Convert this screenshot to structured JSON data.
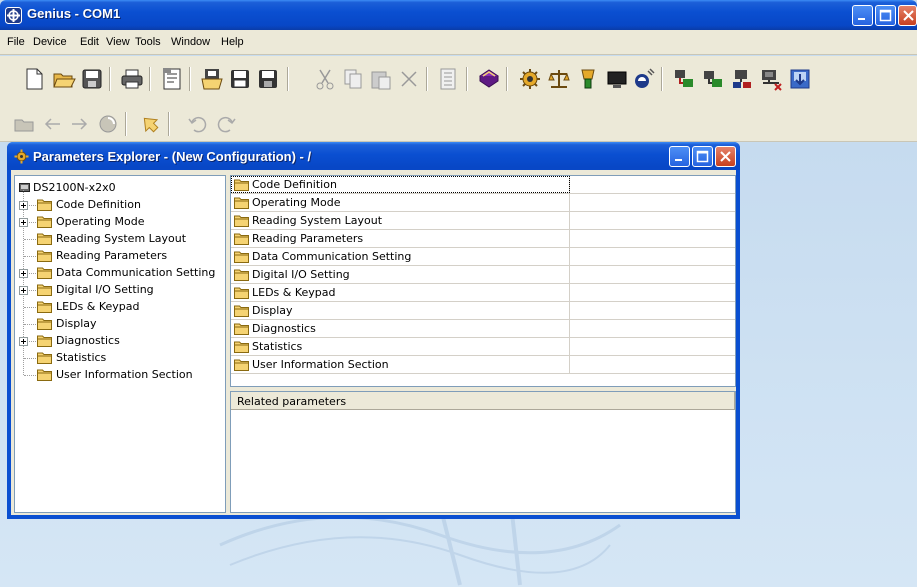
{
  "app": {
    "title": "Genius - COM1",
    "icon": "genius-app-icon"
  },
  "menu": [
    "File",
    "Device",
    "Edit",
    "View",
    "Tools",
    "Window",
    "Help"
  ],
  "toolbar": {
    "row1_icons": [
      "new-file-icon",
      "open-folder-icon",
      "save-icon",
      "print-icon",
      "properties-icon",
      "open-config-icon",
      "save-config-icon",
      "save-all-icon",
      "cut-icon",
      "copy-icon",
      "paste-icon",
      "delete-icon",
      "list-icon",
      "book-icon",
      "device-settings-icon",
      "balance-icon",
      "scanner-icon",
      "monitor-icon",
      "satellite-icon",
      "network-icon",
      "network-add-icon",
      "network-remove-icon",
      "network-error-icon",
      "download-icon"
    ],
    "row2_icons": [
      "folder-up-icon",
      "back-arrow-icon",
      "forward-arrow-icon",
      "refresh-icon",
      "send-icon",
      "undo-icon",
      "redo-icon"
    ]
  },
  "child_window": {
    "title": "Parameters Explorer - (New Configuration) - /",
    "icon": "gear-icon"
  },
  "tree": {
    "root": "DS2100N-x2x0",
    "items": [
      {
        "label": "Code Definition",
        "expandable": true
      },
      {
        "label": "Operating Mode",
        "expandable": true
      },
      {
        "label": "Reading System Layout",
        "expandable": false
      },
      {
        "label": "Reading Parameters",
        "expandable": false
      },
      {
        "label": "Data Communication Setting",
        "expandable": true
      },
      {
        "label": "Digital I/O Setting",
        "expandable": true
      },
      {
        "label": "LEDs & Keypad",
        "expandable": false
      },
      {
        "label": "Display",
        "expandable": false
      },
      {
        "label": "Diagnostics",
        "expandable": true
      },
      {
        "label": "Statistics",
        "expandable": false
      },
      {
        "label": "User Information Section",
        "expandable": false
      }
    ]
  },
  "list": {
    "rows": [
      "Code Definition",
      "Operating Mode",
      "Reading System Layout",
      "Reading Parameters",
      "Data Communication Setting",
      "Digital I/O Setting",
      "LEDs & Keypad",
      "Display",
      "Diagnostics",
      "Statistics",
      "User Information Section"
    ]
  },
  "related": {
    "header": "Related parameters"
  },
  "colors": {
    "titlebar": "#0a4fd1",
    "face": "#ece9d8",
    "workspace": "#c6dbef",
    "folder": "#f5d372"
  }
}
